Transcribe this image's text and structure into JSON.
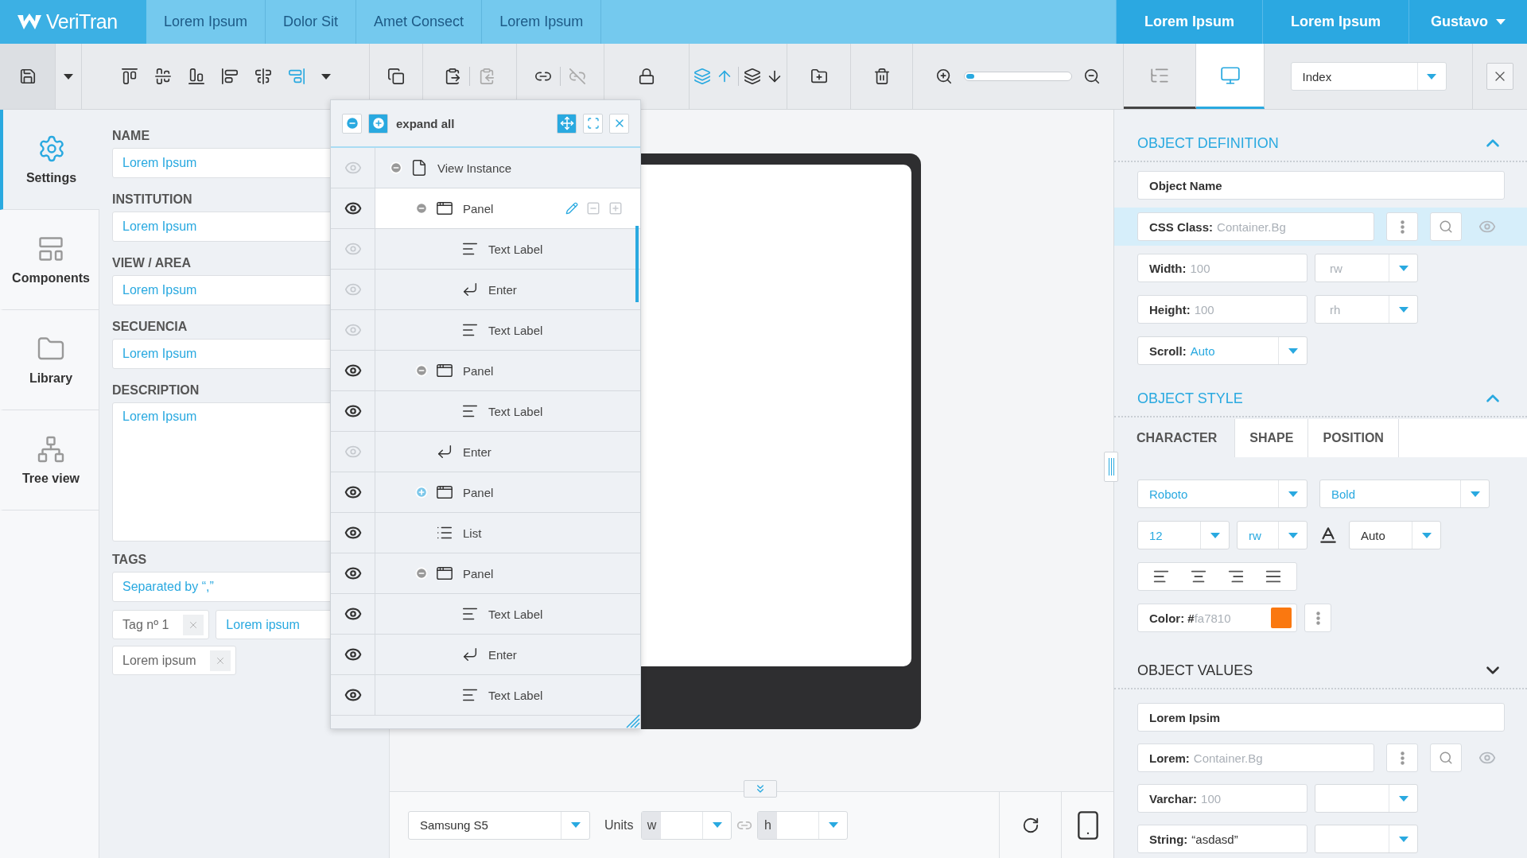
{
  "top_nav": {
    "logo": "VeriTran",
    "tabs": [
      "Lorem Ipsum",
      "Dolor Sit",
      "Amet Consect",
      "Lorem Ipsum"
    ],
    "right_tabs": [
      "Lorem Ipsum",
      "Lorem Ipsum"
    ],
    "user": "Gustavo"
  },
  "toolbar": {
    "align_tools": [
      {
        "kind": "top",
        "selected": false
      },
      {
        "kind": "middle",
        "selected": false
      },
      {
        "kind": "bottom",
        "selected": false
      },
      {
        "kind": "left",
        "selected": false
      },
      {
        "kind": "center",
        "selected": false
      },
      {
        "kind": "right",
        "selected": true
      }
    ],
    "zoom": {
      "level": 0.04
    },
    "view_modes": [
      {
        "kind": "tree",
        "selected": false
      },
      {
        "kind": "screen",
        "selected": true
      }
    ],
    "page_select": "Index"
  },
  "side_nav": [
    {
      "kind": "settings",
      "label": "Settings",
      "selected": true
    },
    {
      "kind": "components",
      "label": "Components",
      "selected": false
    },
    {
      "kind": "library",
      "label": "Library",
      "selected": false
    },
    {
      "kind": "tree",
      "label": "Tree view",
      "selected": false
    }
  ],
  "form": {
    "fields": [
      {
        "label": "NAME",
        "value": "Lorem Ipsum",
        "kind": "line"
      },
      {
        "label": "INSTITUTION",
        "value": "Lorem Ipsum",
        "kind": "line"
      },
      {
        "label": "VIEW / AREA",
        "value": "Lorem Ipsum",
        "kind": "line"
      },
      {
        "label": "SECUENCIA",
        "value": "Lorem Ipsum",
        "kind": "line"
      },
      {
        "label": "DESCRIPTION",
        "value": "Lorem Ipsum",
        "kind": "area"
      }
    ],
    "tags": {
      "label": "TAGS",
      "value": "Separated by “,”",
      "chips": [
        {
          "text": "Tag nº 1",
          "kind": "chip"
        },
        {
          "text": "Lorem ipsum",
          "kind": "entry"
        },
        {
          "text": "Lorem ipsum",
          "kind": "chip"
        }
      ]
    }
  },
  "tree_panel": {
    "action": "expand all",
    "nodes": [
      {
        "label": "View Instance",
        "kind": "page",
        "visible": false,
        "expanded": true,
        "selected": false,
        "children": [
          {
            "label": "Panel",
            "kind": "panel",
            "visible": true,
            "expanded": true,
            "selected": true,
            "children": [
              {
                "label": "Text Label",
                "kind": "text",
                "visible": false,
                "selected": false
              },
              {
                "label": "Enter",
                "kind": "enter",
                "visible": false,
                "selected": false
              },
              {
                "label": "Text Label",
                "kind": "text",
                "visible": false,
                "selected": false
              }
            ]
          },
          {
            "label": "Panel",
            "kind": "panel",
            "visible": true,
            "expanded": true,
            "selected": false,
            "children": [
              {
                "label": "Text Label",
                "kind": "text",
                "visible": true,
                "selected": false
              }
            ]
          },
          {
            "label": "Enter",
            "kind": "enter",
            "visible": false,
            "selected": false
          },
          {
            "label": "Panel",
            "kind": "panel",
            "visible": true,
            "expanded": false,
            "selected": false
          },
          {
            "label": "List",
            "kind": "list",
            "visible": true,
            "selected": false
          },
          {
            "label": "Panel",
            "kind": "panel",
            "visible": true,
            "expanded": true,
            "selected": false,
            "children": [
              {
                "label": "Text Label",
                "kind": "text",
                "visible": true,
                "selected": false
              },
              {
                "label": "Enter",
                "kind": "enter",
                "visible": true,
                "selected": false
              },
              {
                "label": "Text Label",
                "kind": "text",
                "visible": true,
                "selected": false
              }
            ]
          }
        ]
      }
    ]
  },
  "canvas": {
    "device": "Samsung S5",
    "units_label": "Units",
    "width_label": "w",
    "height_label": "h"
  },
  "inspector": {
    "definition": {
      "title": "OBJECT DEFINITION",
      "expanded": true,
      "rows": [
        {
          "kind": "text",
          "value": "Object Name"
        },
        {
          "kind": "lookup",
          "label": "CSS Class:",
          "placeholder": "Container.Bg",
          "highlighted": true
        },
        {
          "kind": "unit",
          "label": "Width:",
          "placeholder": "100",
          "unit": "rw"
        },
        {
          "kind": "unit",
          "label": "Height:",
          "placeholder": "100",
          "unit": "rh"
        },
        {
          "kind": "select",
          "label": "Scroll:",
          "value": "Auto"
        }
      ]
    },
    "style": {
      "title": "OBJECT STYLE",
      "expanded": true,
      "tabs": [
        {
          "label": "CHARACTER",
          "selected": true
        },
        {
          "label": "SHAPE",
          "selected": false
        },
        {
          "label": "POSITION",
          "selected": false
        }
      ],
      "font": "Roboto",
      "weight": "Bold",
      "size": "12",
      "size_unit": "rw",
      "line_height": "Auto",
      "color": {
        "label": "Color: #",
        "placeholder": "fa7810"
      }
    },
    "values": {
      "title": "OBJECT VALUES",
      "expanded": false,
      "rows": [
        {
          "kind": "text",
          "value": "Lorem Ipsim"
        },
        {
          "kind": "lookup",
          "label": "Lorem:",
          "placeholder": "Container.Bg",
          "highlighted": false
        },
        {
          "kind": "unit",
          "label": "Varchar:",
          "placeholder": "100"
        },
        {
          "kind": "unit",
          "label": "String:",
          "value": "“asdasd”"
        }
      ]
    }
  }
}
